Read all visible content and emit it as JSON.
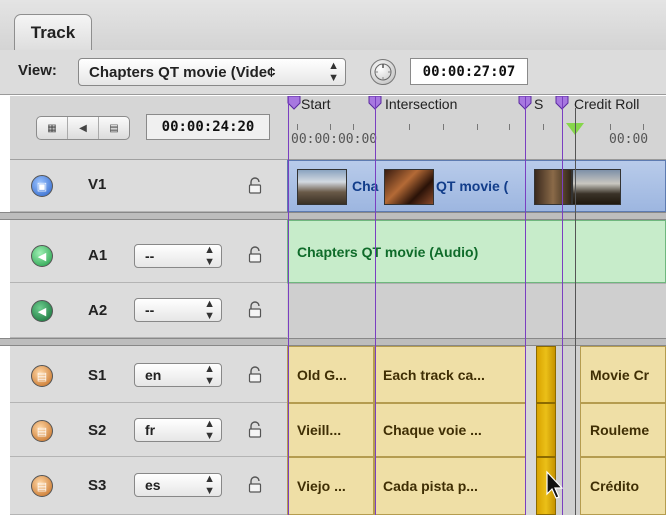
{
  "tab": {
    "label": "Track"
  },
  "toolbar": {
    "view_label": "View:",
    "view_value": "Chapters QT movie (Vide¢",
    "timecode": "00:00:27:07"
  },
  "side": {
    "timecode": "00:00:24:20"
  },
  "ruler": {
    "markers": [
      "Start",
      "Intersection",
      "S",
      "Credit Roll"
    ],
    "timecodes": [
      "00:00:00:00",
      "00:00"
    ]
  },
  "tracks": {
    "v1": {
      "name": "V1",
      "clip": "Chapters QT movie (Video)",
      "clip_label_left": "Cha",
      "clip_label_right": "QT movie ("
    },
    "a1": {
      "name": "A1",
      "popup": "--",
      "clip": "Chapters QT movie (Audio)"
    },
    "a2": {
      "name": "A2",
      "popup": "--"
    },
    "s1": {
      "name": "S1",
      "popup": "en",
      "clips": [
        "Old G...",
        "Each track ca...",
        "Movie Cr"
      ]
    },
    "s2": {
      "name": "S2",
      "popup": "fr",
      "clips": [
        "Vieill...",
        "Chaque voie ...",
        "Rouleme"
      ]
    },
    "s3": {
      "name": "S3",
      "popup": "es",
      "clips": [
        "Viejo ...",
        "Cada pista p...",
        "Crédito"
      ]
    }
  },
  "colors": {
    "marker": "#7a3fc1",
    "playhead": "#86d64a",
    "video_clip": "#9db6e0",
    "audio_clip": "#c7ecca",
    "subtitle_clip": "#efdfa6",
    "subtitle_gold": "#d9a300"
  },
  "icons": {
    "video_track": "film-icon",
    "audio_track": "speaker-icon",
    "subtitle_track": "subtitle-icon",
    "lock": "lock-icon",
    "dial": "jog-dial-icon"
  }
}
